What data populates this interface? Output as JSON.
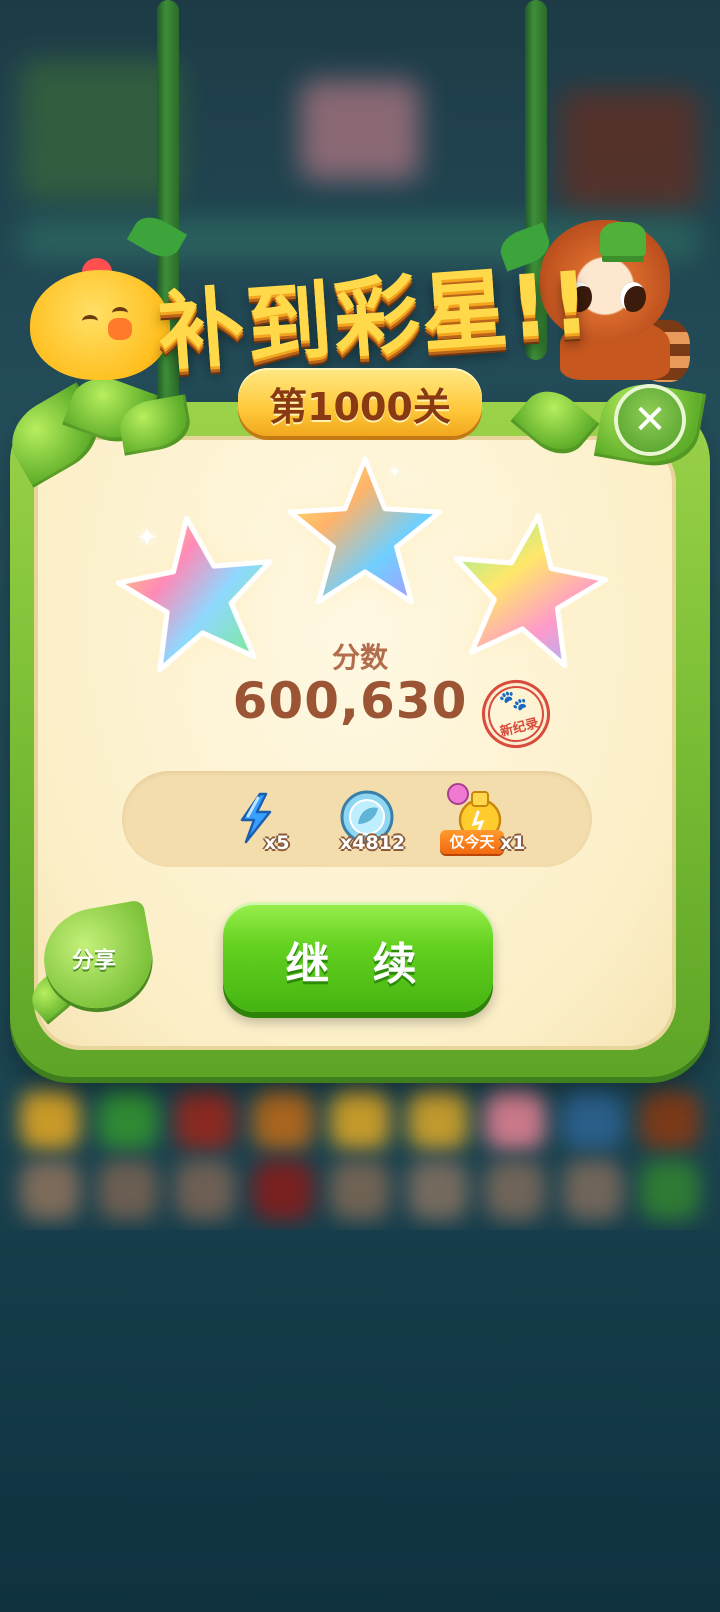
{
  "title": "补到彩星!!",
  "level_badge": "第1000关",
  "stars_earned": 3,
  "score": {
    "label": "分数",
    "value": "600,630",
    "record_badge": "新纪录"
  },
  "rewards": [
    {
      "icon": "lightning-icon",
      "quantity": "x5"
    },
    {
      "icon": "leaf-coin-icon",
      "quantity": "x4812"
    },
    {
      "icon": "potion-bottle-icon",
      "quantity": "x1",
      "badge": "仅今天"
    }
  ],
  "buttons": {
    "continue": "继 续",
    "share": "分享",
    "close": "✕"
  },
  "colors": {
    "frame_green": "#79bd34",
    "panel_cream": "#fcefc7",
    "title_gold": "#ffd94a",
    "button_green": "#63d11f",
    "score_brown": "#9c5534"
  }
}
